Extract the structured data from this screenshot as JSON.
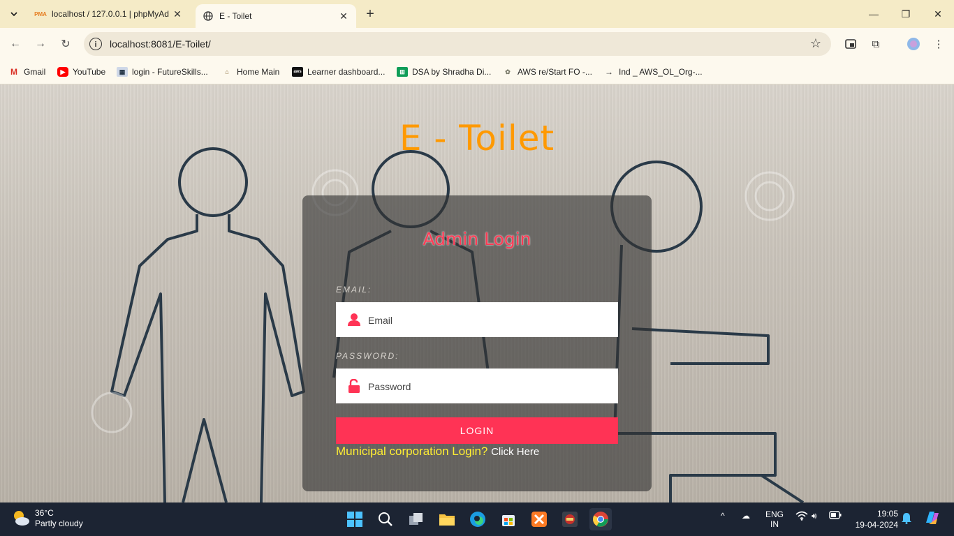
{
  "browser": {
    "tabs": [
      {
        "title": "localhost / 127.0.0.1 | phpMyAd",
        "favicon": "PMA",
        "active": false
      },
      {
        "title": "E - Toilet",
        "favicon": "globe-icon",
        "active": true
      }
    ],
    "new_tab_label": "+",
    "url": "localhost:8081/E-Toilet/",
    "bookmarks": [
      {
        "label": "Gmail",
        "icon": "gmail-icon"
      },
      {
        "label": "YouTube",
        "icon": "youtube-icon"
      },
      {
        "label": "login - FutureSkills...",
        "icon": "futureskills-icon"
      },
      {
        "label": "Home Main",
        "icon": "home-main-icon"
      },
      {
        "label": "Learner dashboard...",
        "icon": "aws-icon"
      },
      {
        "label": "DSA by Shradha Di...",
        "icon": "sheets-icon"
      },
      {
        "label": "AWS re/Start FO -...",
        "icon": "awsrestart-icon"
      },
      {
        "label": "Ind _ AWS_OL_Org-...",
        "icon": "arrow-icon"
      }
    ]
  },
  "page": {
    "site_title": "E - Toilet",
    "login": {
      "heading": "Admin Login",
      "email_label": "EMAIL:",
      "email_placeholder": "Email",
      "password_label": "PASSWORD:",
      "password_placeholder": "Password",
      "button_label": "LOGIN",
      "municipal_question": "Municipal corporation Login?",
      "municipal_link": "Click Here"
    },
    "colors": {
      "title": "#ff9900",
      "heading": "#ff3b55",
      "button": "#ff3355",
      "municipal_question": "#ffee33"
    }
  },
  "taskbar": {
    "weather_temp": "36°C",
    "weather_desc": "Partly cloudy",
    "language_top": "ENG",
    "language_bottom": "IN",
    "time": "19:05",
    "date": "19-04-2024"
  }
}
